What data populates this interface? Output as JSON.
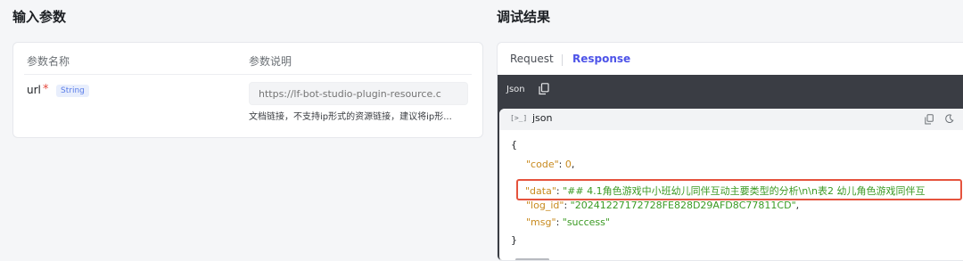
{
  "left": {
    "title": "输入参数",
    "table": {
      "col_name": "参数名称",
      "col_desc": "参数说明",
      "params": [
        {
          "name": "url",
          "required_mark": "*",
          "type": "String",
          "placeholder": "https://lf-bot-studio-plugin-resource.c",
          "hint": "文档链接，不支持ip形式的资源链接，建议将ip形..."
        }
      ]
    }
  },
  "right": {
    "title": "调试结果",
    "tabs": {
      "request": "Request",
      "response": "Response",
      "active": "response"
    },
    "format_label": "Json",
    "code_header_icon": "[>_]",
    "code_label": "json",
    "json_lines": {
      "open": "{",
      "code_key": "\"code\"",
      "code_val": "0",
      "data_key": "\"data\"",
      "data_val": "\"## 4.1角色游戏中小班幼儿同伴互动主要类型的分析\\n\\n表2 幼儿角色游戏同伴互",
      "log_id_key": "\"log_id\"",
      "log_id_val": "\"20241227172728FE828D29AFD8C77811CD\"",
      "msg_key": "\"msg\"",
      "msg_val": "\"success\"",
      "close": "}"
    },
    "colors": {
      "accent": "#4d53e8",
      "highlight": "#e5533d",
      "key": "#c88a1e",
      "string": "#3b9a23"
    }
  }
}
